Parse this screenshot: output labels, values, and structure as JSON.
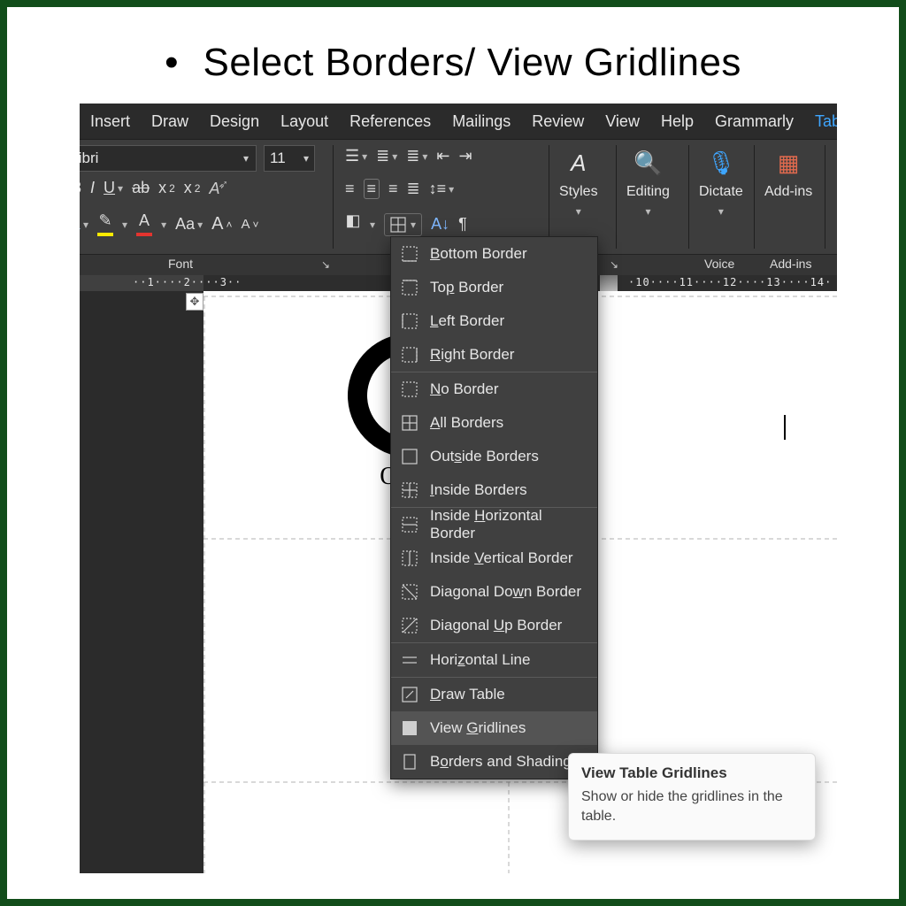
{
  "heading": "Select Borders/ View Gridlines",
  "tabs": [
    "Insert",
    "Draw",
    "Design",
    "Layout",
    "References",
    "Mailings",
    "Review",
    "View",
    "Help",
    "Grammarly",
    "Table"
  ],
  "font": {
    "name": "libri",
    "size": "11"
  },
  "groups": {
    "font": "Font",
    "voice": "Voice",
    "addins": "Add-ins"
  },
  "big": {
    "styles": "Styles",
    "editing": "Editing",
    "dictate": "Dictate",
    "addins": "Add-ins"
  },
  "logo_text": "Offic",
  "tooltip": {
    "title": "View Table Gridlines",
    "body": "Show or hide the gridlines in the table."
  },
  "menu": {
    "items": [
      {
        "pre": "",
        "acc": "B",
        "post": "ottom Border"
      },
      {
        "pre": "To",
        "acc": "p",
        "post": " Border"
      },
      {
        "pre": "",
        "acc": "L",
        "post": "eft Border"
      },
      {
        "pre": "",
        "acc": "R",
        "post": "ight Border"
      }
    ],
    "group2": [
      {
        "pre": "",
        "acc": "N",
        "post": "o Border"
      },
      {
        "pre": "",
        "acc": "A",
        "post": "ll Borders"
      },
      {
        "pre": "Out",
        "acc": "s",
        "post": "ide Borders"
      },
      {
        "pre": "",
        "acc": "I",
        "post": "nside Borders"
      }
    ],
    "group3": [
      {
        "pre": "Inside ",
        "acc": "H",
        "post": "orizontal Border"
      },
      {
        "pre": "Inside ",
        "acc": "V",
        "post": "ertical Border"
      },
      {
        "pre": "Diagonal Do",
        "acc": "w",
        "post": "n Border"
      },
      {
        "pre": "Diagonal ",
        "acc": "U",
        "post": "p Border"
      }
    ],
    "group4": [
      {
        "pre": "Hori",
        "acc": "z",
        "post": "ontal Line"
      }
    ],
    "group5": [
      {
        "pre": "",
        "acc": "D",
        "post": "raw Table"
      },
      {
        "pre": "View ",
        "acc": "G",
        "post": "ridlines",
        "hover": true
      },
      {
        "pre": "B",
        "acc": "o",
        "post": "rders and Shading..."
      }
    ]
  },
  "ruler": {
    "left": "··1····2····3··",
    "right": "·10····11····12····13····14·"
  }
}
